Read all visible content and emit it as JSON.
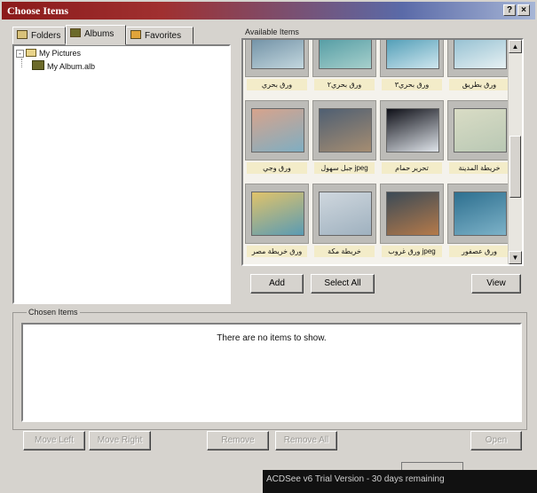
{
  "window": {
    "title": "Choose Items",
    "help_glyph": "?",
    "close_glyph": "×"
  },
  "tabs": [
    {
      "label": "Folders",
      "active": false
    },
    {
      "label": "Albums",
      "active": true
    },
    {
      "label": "Favorites",
      "active": false
    }
  ],
  "tree": {
    "root": {
      "label": "My Pictures",
      "expander": "-"
    },
    "child": {
      "label": "My Album.alb"
    }
  },
  "available": {
    "label": "Available Items",
    "items": [
      {
        "caption": "ورق بحري",
        "colors": [
          "#5c7f97",
          "#c3d7de"
        ]
      },
      {
        "caption": "ورق بحري۲",
        "colors": [
          "#3f8f9a",
          "#a7d0cc"
        ]
      },
      {
        "caption": "ورق بحري۳",
        "colors": [
          "#2f8aa8",
          "#cfe6ee"
        ]
      },
      {
        "caption": "ورق بطريق",
        "colors": [
          "#7fb3c9",
          "#e7f1f3"
        ]
      },
      {
        "caption": "ورق وجي",
        "colors": [
          "#d7a38c",
          "#7faec2"
        ]
      },
      {
        "caption": "جبل سهول jpeg",
        "colors": [
          "#4f5f72",
          "#a58d72"
        ]
      },
      {
        "caption": "تحرير حمام",
        "colors": [
          "#0f1018",
          "#dfe4ea"
        ]
      },
      {
        "caption": "خريطة المدينة",
        "colors": [
          "#d9dcc5",
          "#b9c8b4"
        ]
      },
      {
        "caption": "ورق خريطة مصر",
        "colors": [
          "#e0c36a",
          "#5a9bb3"
        ]
      },
      {
        "caption": "خريطة مكة",
        "colors": [
          "#cfd7de",
          "#9fb1bf"
        ]
      },
      {
        "caption": "ورق غروب jpeg",
        "colors": [
          "#3b4a56",
          "#b57a4a"
        ]
      },
      {
        "caption": "ورق عصفور",
        "colors": [
          "#2d6f8f",
          "#7db2c8"
        ]
      }
    ],
    "scroll_up": "▲",
    "scroll_down": "▼"
  },
  "buttons": {
    "add": "Add",
    "select_all": "Select All",
    "view": "View",
    "move_left": "Move Left",
    "move_right": "Move Right",
    "remove": "Remove",
    "remove_all": "Remove All",
    "open": "Open"
  },
  "chosen": {
    "label": "Chosen Items",
    "empty_message": "There are no items to show."
  },
  "status": {
    "text": "ACDSee v6 Trial Version - 30 days remaining"
  }
}
